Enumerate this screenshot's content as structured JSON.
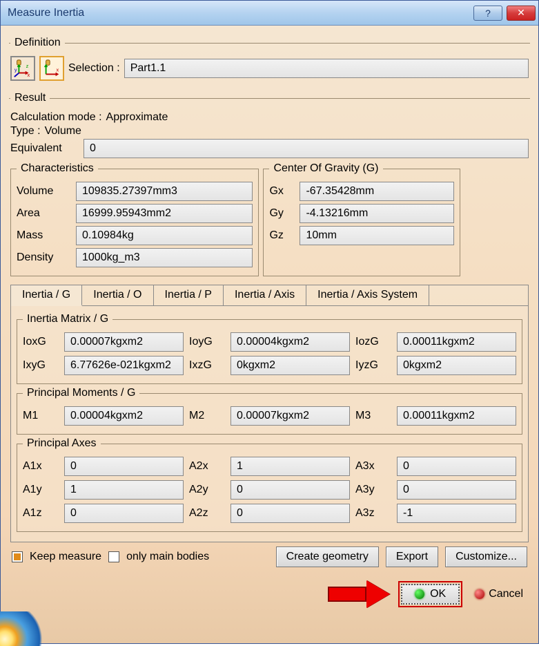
{
  "title": "Measure Inertia",
  "definition": {
    "legend": "Definition",
    "selection_label": "Selection :",
    "selection_value": "Part1.1"
  },
  "result": {
    "legend": "Result",
    "calc_mode_label": "Calculation mode :",
    "calc_mode_value": "Approximate",
    "type_label": "Type :",
    "type_value": "Volume",
    "equivalent_label": "Equivalent",
    "equivalent_value": "0"
  },
  "characteristics": {
    "legend": "Characteristics",
    "rows": [
      {
        "k": "Volume",
        "v": "109835.27397mm3"
      },
      {
        "k": "Area",
        "v": "16999.95943mm2"
      },
      {
        "k": "Mass",
        "v": "0.10984kg"
      },
      {
        "k": "Density",
        "v": "1000kg_m3"
      }
    ]
  },
  "cog": {
    "legend": "Center Of Gravity (G)",
    "rows": [
      {
        "k": "Gx",
        "v": "-67.35428mm"
      },
      {
        "k": "Gy",
        "v": "-4.13216mm"
      },
      {
        "k": "Gz",
        "v": "10mm"
      }
    ]
  },
  "tabs": [
    "Inertia / G",
    "Inertia / O",
    "Inertia / P",
    "Inertia / Axis",
    "Inertia / Axis System"
  ],
  "inertia_g": {
    "matrix_legend": "Inertia Matrix / G",
    "matrix": [
      {
        "k": "IoxG",
        "v": "0.00007kgxm2"
      },
      {
        "k": "IoyG",
        "v": "0.00004kgxm2"
      },
      {
        "k": "IozG",
        "v": "0.00011kgxm2"
      },
      {
        "k": "IxyG",
        "v": "6.77626e-021kgxm2"
      },
      {
        "k": "IxzG",
        "v": "0kgxm2"
      },
      {
        "k": "IyzG",
        "v": "0kgxm2"
      }
    ],
    "moments_legend": "Principal Moments / G",
    "moments": [
      {
        "k": "M1",
        "v": "0.00004kgxm2"
      },
      {
        "k": "M2",
        "v": "0.00007kgxm2"
      },
      {
        "k": "M3",
        "v": "0.00011kgxm2"
      }
    ],
    "axes_legend": "Principal Axes",
    "axes": [
      {
        "k": "A1x",
        "v": "0"
      },
      {
        "k": "A2x",
        "v": "1"
      },
      {
        "k": "A3x",
        "v": "0"
      },
      {
        "k": "A1y",
        "v": "1"
      },
      {
        "k": "A2y",
        "v": "0"
      },
      {
        "k": "A3y",
        "v": "0"
      },
      {
        "k": "A1z",
        "v": "0"
      },
      {
        "k": "A2z",
        "v": "0"
      },
      {
        "k": "A3z",
        "v": "-1"
      }
    ]
  },
  "options": {
    "keep_measure_label": "Keep measure",
    "only_main_bodies_label": "only main bodies",
    "keep_measure_checked": true,
    "only_main_bodies_checked": false
  },
  "buttons": {
    "create_geometry": "Create geometry",
    "export": "Export",
    "customize": "Customize...",
    "ok": "OK",
    "cancel": "Cancel"
  }
}
